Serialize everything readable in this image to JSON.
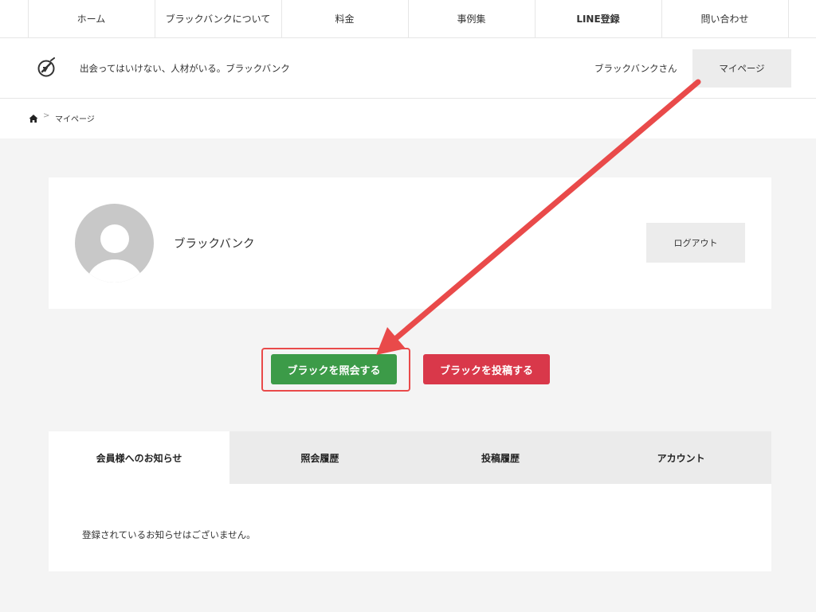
{
  "nav": {
    "items": [
      {
        "label": "ホーム"
      },
      {
        "label": "ブラックバンクについて"
      },
      {
        "label": "料金"
      },
      {
        "label": "事例集"
      },
      {
        "label": "LINE登録"
      },
      {
        "label": "問い合わせ"
      }
    ]
  },
  "header": {
    "tagline": "出会ってはいけない、人材がいる。ブラックバンク",
    "username": "ブラックバンクさん",
    "mypage_label": "マイページ"
  },
  "breadcrumb": {
    "separator": ">",
    "current": "マイページ"
  },
  "profile": {
    "name": "ブラックバンク",
    "logout_label": "ログアウト"
  },
  "actions": {
    "query_label": "ブラックを照会する",
    "post_label": "ブラックを投稿する"
  },
  "tabs": [
    {
      "label": "会員様へのお知らせ"
    },
    {
      "label": "照会履歴"
    },
    {
      "label": "投稿履歴"
    },
    {
      "label": "アカウント"
    }
  ],
  "notice": {
    "text": "登録されているお知らせはございません。"
  },
  "colors": {
    "query_button": "#3c9b48",
    "post_button": "#d9384a",
    "annotation": "#e94a4a"
  }
}
